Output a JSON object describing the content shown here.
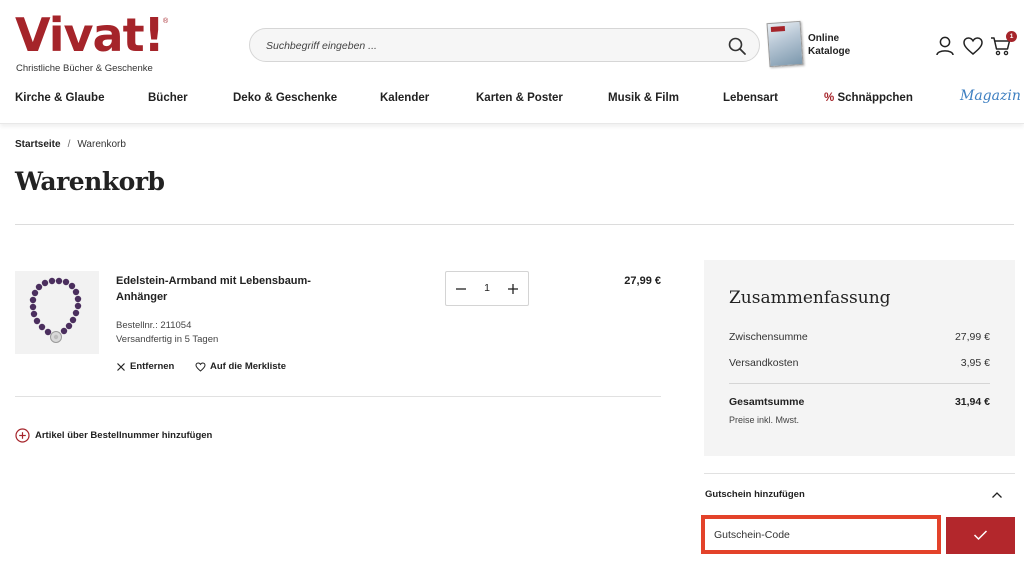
{
  "brand": {
    "logo_text": "Vivat!",
    "registered": "®",
    "tagline": "Christliche Bücher & Geschenke",
    "accent_color": "#a5242a"
  },
  "search": {
    "placeholder": "Suchbegriff eingeben ...",
    "icon": "search-icon"
  },
  "catalog": {
    "label": "Online\nKataloge"
  },
  "header_icons": {
    "account": "user-icon",
    "wishlist": "heart-icon",
    "cart": "cart-icon",
    "cart_count": "1"
  },
  "nav": {
    "items": [
      {
        "label": "Kirche & Glaube"
      },
      {
        "label": "Bücher"
      },
      {
        "label": "Deko & Geschenke"
      },
      {
        "label": "Kalender"
      },
      {
        "label": "Karten & Poster"
      },
      {
        "label": "Musik & Film"
      },
      {
        "label": "Lebensart"
      },
      {
        "label": "Schnäppchen",
        "prefix": "%"
      }
    ],
    "magazin": "Magazin"
  },
  "breadcrumb": {
    "home": "Startseite",
    "separator": "/",
    "current": "Warenkorb"
  },
  "page_title": "Warenkorb",
  "cart": {
    "item": {
      "name": "Edelstein-Armband mit Lebensbaum-Anhänger",
      "order_number": "Bestellnr.: 211054",
      "shipping": "Versandfertig in 5 Tagen",
      "remove_label": "Entfernen",
      "wishlist_label": "Auf die Merkliste",
      "quantity": "1",
      "price": "27,99 €"
    },
    "add_by_number": "Artikel über Bestellnummer hinzufügen"
  },
  "summary": {
    "title": "Zusammenfassung",
    "subtotal_label": "Zwischensumme",
    "subtotal_value": "27,99 €",
    "shipping_label": "Versandkosten",
    "shipping_value": "3,95 €",
    "total_label": "Gesamtsumme",
    "total_value": "31,94 €",
    "tax_note": "Preise inkl. Mwst."
  },
  "voucher": {
    "heading": "Gutschein hinzufügen",
    "placeholder": "Gutschein-Code",
    "submit_icon": "check-icon"
  }
}
